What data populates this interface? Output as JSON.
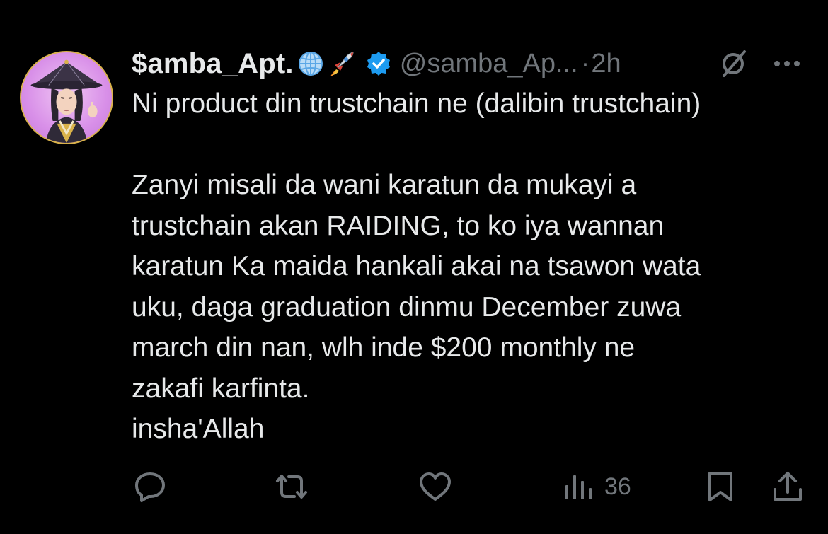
{
  "author": {
    "display_name": "$amba_Apt.",
    "emojis": [
      "globe-icon",
      "rocket-icon"
    ],
    "verified": true,
    "handle": "@samba_Ap...",
    "separator": "·",
    "time": "2h"
  },
  "tweet": {
    "lines": [
      "Ni product din trustchain ne (dalibin trustchain)",
      "",
      "Zanyi misali da wani karatun da mukayi a",
      "trustchain akan RAIDING, to ko iya wannan",
      "karatun Ka maida hankali akai na tsawon wata",
      "uku, daga graduation dinmu December zuwa",
      "march din nan, wlh inde $200 monthly ne",
      "zakafi karfinta.",
      "insha'Allah"
    ]
  },
  "actions": {
    "reply": "reply-icon",
    "retweet": "retweet-icon",
    "like": "like-icon",
    "views_count": "36",
    "bookmark": "bookmark-icon",
    "share": "share-icon"
  },
  "colors": {
    "background": "#000000",
    "text": "#e7e9ea",
    "muted": "#71767b",
    "verified": "#1d9bf0"
  }
}
